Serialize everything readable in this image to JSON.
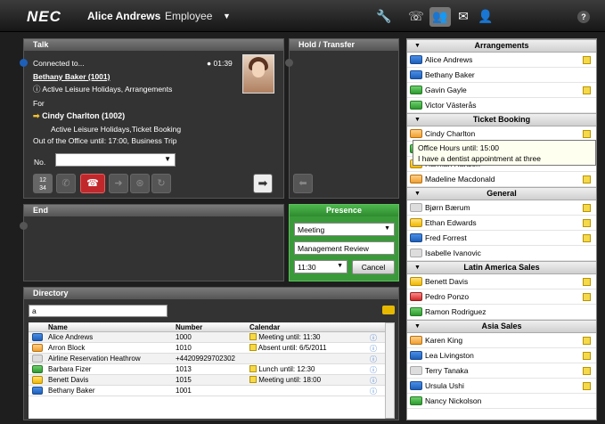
{
  "header": {
    "logo": "NEC",
    "user_name": "Alice Andrews",
    "user_role": "Employee",
    "icons": [
      "tool-icon",
      "phone-list-icon",
      "group-icon",
      "voicemail-icon",
      "user-icon",
      "help-icon"
    ],
    "help_label": "?"
  },
  "talk": {
    "title": "Talk",
    "status": "Connected to...",
    "timer": "01:39",
    "caller": "Bethany Baker (1001)",
    "caller_info": "Active Leisure Holidays, Arrangements",
    "for_label": "For",
    "forwarded_to": "Cindy Charlton (1002)",
    "forwarded_info": "Active Leisure Holidays,Ticket Booking",
    "out_of_office": "Out of the Office until: 17:00, Business Trip",
    "number_label": "No.",
    "number_value": ""
  },
  "hold": {
    "title": "Hold / Transfer"
  },
  "end": {
    "title": "End"
  },
  "presence": {
    "title": "Presence",
    "status": "Meeting",
    "note": "Management Review",
    "time": "11:30",
    "cancel_label": "Cancel"
  },
  "directory": {
    "title": "Directory",
    "search_value": "a",
    "columns": {
      "name": "Name",
      "number": "Number",
      "calendar": "Calendar"
    },
    "rows": [
      {
        "name": "Alice Andrews",
        "number": "1000",
        "calendar": "Meeting until: 11:30",
        "status": "blue"
      },
      {
        "name": "Arron Block",
        "number": "1010",
        "calendar": "Absent until: 6/5/2011",
        "status": "orange"
      },
      {
        "name": "Airline Reservation Heathrow",
        "number": "+44209929702302",
        "calendar": "",
        "status": "gray"
      },
      {
        "name": "Barbara Fizer",
        "number": "1013",
        "calendar": "Lunch until: 12:30",
        "status": "green"
      },
      {
        "name": "Benett Davis",
        "number": "1015",
        "calendar": "Meeting until: 18:00",
        "status": "yellow"
      },
      {
        "name": "Bethany Baker",
        "number": "1001",
        "calendar": "",
        "status": "blue"
      }
    ]
  },
  "contacts": {
    "groups": [
      {
        "title": "Arrangements",
        "items": [
          {
            "name": "Alice Andrews",
            "status": "blue",
            "cal": true
          },
          {
            "name": "Bethany Baker",
            "status": "blue",
            "cal": false
          },
          {
            "name": "Gavin Gayle",
            "status": "green",
            "cal": true
          },
          {
            "name": "Victor Västerås",
            "status": "green",
            "cal": false
          }
        ]
      },
      {
        "title": "Ticket Booking",
        "items": [
          {
            "name": "Cindy Charlton",
            "status": "orange",
            "cal": true
          },
          {
            "name": "",
            "status": "green",
            "cal": false
          },
          {
            "name": "Harman Hansen",
            "status": "yellow",
            "cal": false
          },
          {
            "name": "Madeline Macdonald",
            "status": "orange",
            "cal": true
          }
        ]
      },
      {
        "title": "General",
        "items": [
          {
            "name": "Bjørn Bærum",
            "status": "gray",
            "cal": true
          },
          {
            "name": "Ethan Edwards",
            "status": "yellow",
            "cal": true
          },
          {
            "name": "Fred Forrest",
            "status": "blue",
            "cal": true
          },
          {
            "name": "Isabelle Ivanovic",
            "status": "gray",
            "cal": false
          }
        ]
      },
      {
        "title": "Latin America Sales",
        "items": [
          {
            "name": "Benett Davis",
            "status": "yellow",
            "cal": true
          },
          {
            "name": "Pedro Ponzo",
            "status": "red",
            "cal": true
          },
          {
            "name": "Ramon Rodriguez",
            "status": "green",
            "cal": false
          }
        ]
      },
      {
        "title": "Asia Sales",
        "items": [
          {
            "name": "Karen King",
            "status": "orange",
            "cal": true
          },
          {
            "name": "Lea Livingston",
            "status": "blue",
            "cal": true
          },
          {
            "name": "Terry Tanaka",
            "status": "gray",
            "cal": true
          },
          {
            "name": "Ursula Ushi",
            "status": "blue",
            "cal": true
          },
          {
            "name": "Nancy Nickolson",
            "status": "green",
            "cal": false
          }
        ]
      }
    ]
  },
  "tooltip": {
    "line1": "Office Hours until: 15:00",
    "line2": "I have a dentist appointment at three"
  }
}
